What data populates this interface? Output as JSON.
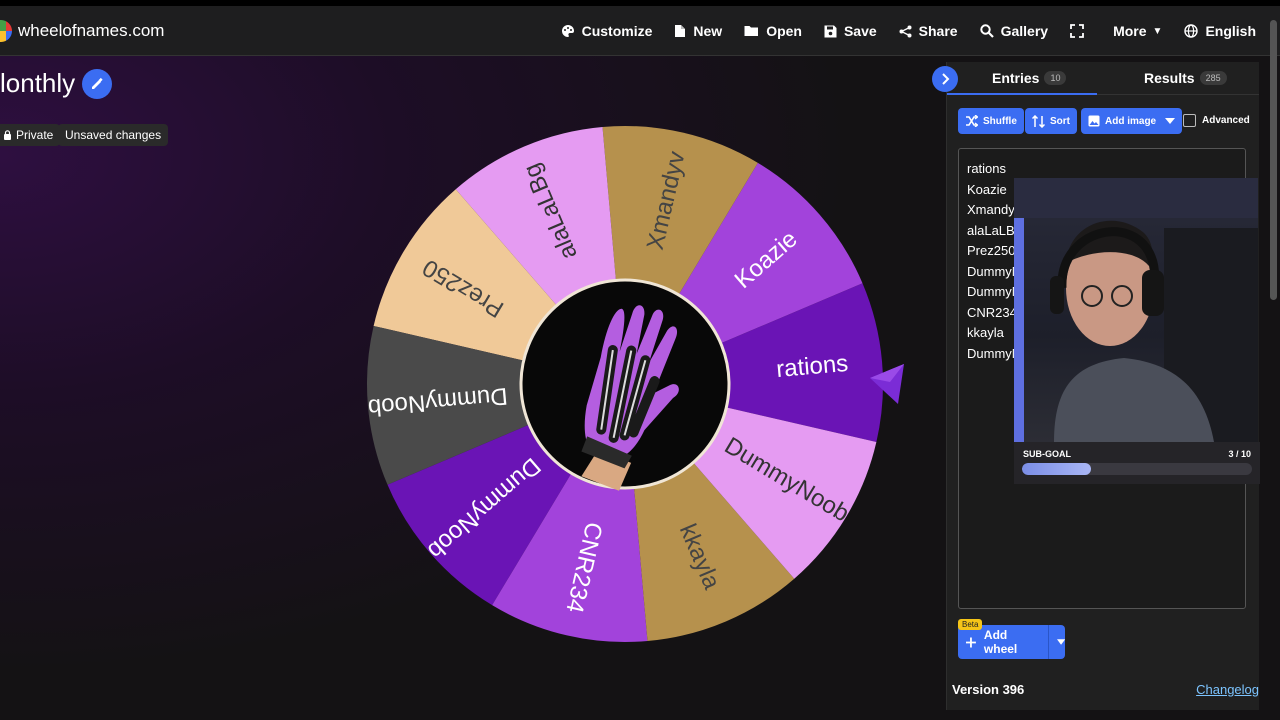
{
  "app": {
    "brand": "wheelofnames.com",
    "nav": [
      {
        "key": "customize",
        "label": "Customize",
        "icon": "palette-icon"
      },
      {
        "key": "new",
        "label": "New",
        "icon": "file-icon"
      },
      {
        "key": "open",
        "label": "Open",
        "icon": "folder-icon"
      },
      {
        "key": "save",
        "label": "Save",
        "icon": "floppy-icon"
      },
      {
        "key": "share",
        "label": "Share",
        "icon": "share-icon"
      },
      {
        "key": "gallery",
        "label": "Gallery",
        "icon": "search-icon"
      },
      {
        "key": "fullscreen",
        "label": "",
        "icon": "fullscreen-icon"
      },
      {
        "key": "more",
        "label": "More",
        "icon": "chevron-down-icon"
      },
      {
        "key": "language",
        "label": "English",
        "icon": "globe-icon"
      }
    ]
  },
  "wheel": {
    "title": "lonthly",
    "private_label": "Private",
    "unsaved_label": "Unsaved changes",
    "slices": [
      {
        "label": "rations",
        "color": "#6a14b5",
        "text_color": "#ffffff"
      },
      {
        "label": "Koazie",
        "color": "#a243db",
        "text_color": "#ffffff"
      },
      {
        "label": "Xmandyv",
        "color": "#b6914d",
        "text_color": "#444444"
      },
      {
        "label": "alaLaLBg",
        "color": "#e59bf2",
        "text_color": "#333333"
      },
      {
        "label": "Prez250",
        "color": "#f0c998",
        "text_color": "#444444"
      },
      {
        "label": "DummyNoob",
        "color": "#4a4a4a",
        "text_color": "#ffffff"
      },
      {
        "label": "DummyNoob",
        "color": "#6a14b5",
        "text_color": "#ffffff"
      },
      {
        "label": "CNR234",
        "color": "#a243db",
        "text_color": "#ffffff"
      },
      {
        "label": "kkayla",
        "color": "#b6914d",
        "text_color": "#444444"
      },
      {
        "label": "DummyNoob",
        "color": "#e59bf2",
        "text_color": "#333333"
      }
    ],
    "center_image": "purple-glove-icon",
    "pointer_color": "#7b2cd6"
  },
  "panel": {
    "tabs": [
      {
        "label": "Entries",
        "count": "10"
      },
      {
        "label": "Results",
        "count": "285"
      }
    ],
    "buttons": {
      "shuffle": "Shuffle",
      "sort": "Sort",
      "add_image": "Add image",
      "advanced": "Advanced"
    },
    "entries": [
      "rations",
      "Koazie",
      "Xmandyv",
      "alaLaLBg",
      "Prez250",
      "DummyN",
      "DummyN",
      "CNR234",
      "kkayla",
      "DummyN"
    ],
    "beta_label": "Beta",
    "add_wheel_label": "Add wheel",
    "version": "Version 396",
    "changelog": "Changelog"
  },
  "overlay": {
    "subgoal_label": "SUB-GOAL",
    "subgoal_count": "3 / 10",
    "subgoal_progress": 0.3
  },
  "colors": {
    "accent": "#3b6df2",
    "topbar": "#1e1e1f",
    "panel": "#202020"
  }
}
